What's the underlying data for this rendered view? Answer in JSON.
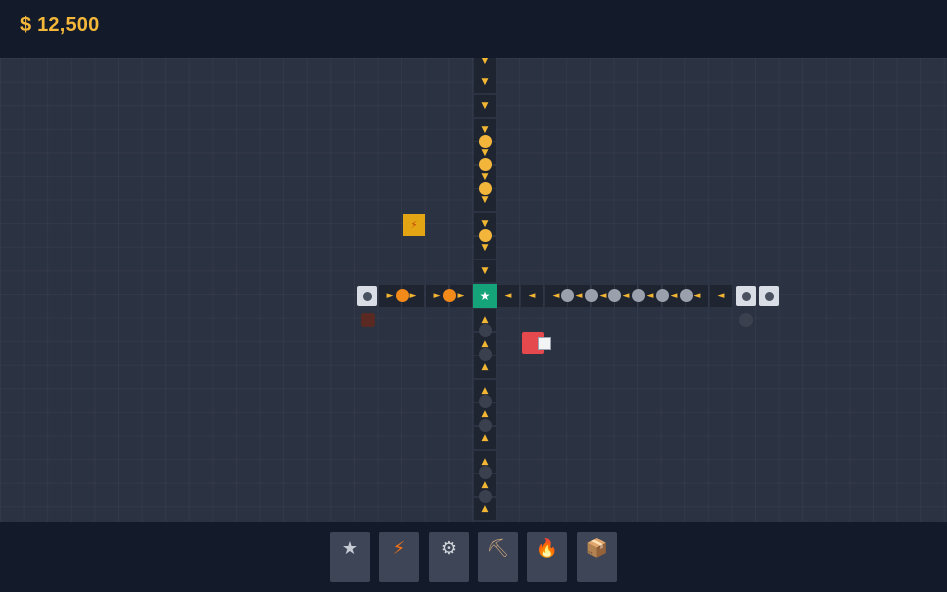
{
  "header": {
    "money": "$ 12,500"
  },
  "board": {
    "hub_icon": "star-icon",
    "hub_glyph": "★",
    "vertical_up_belt": {
      "arrow_glyph": "▼",
      "item_color": "#f4b63a"
    },
    "vertical_down_belt": {
      "arrow_glyph": "▲",
      "item_color": "#3a404e"
    },
    "left_belt": {
      "arrow_glyph": "►",
      "item_color": "#f28a1a"
    },
    "right_belt": {
      "arrow_glyph": "◄",
      "item_color": "#9aa1ad"
    },
    "bolt_tile_glyph": "⚡"
  },
  "toolbar": {
    "tools": [
      {
        "name": "star-tool",
        "icon": "star-icon",
        "glyph": "★",
        "color": "#c6cbd4"
      },
      {
        "name": "power-tool",
        "icon": "lightning-icon",
        "glyph": "⚡",
        "color": "#f97316"
      },
      {
        "name": "gear-tool",
        "icon": "gear-icon",
        "glyph": "⚙",
        "color": "#d1d5db"
      },
      {
        "name": "pickaxe-tool",
        "icon": "pickaxe-icon",
        "glyph": "⛏",
        "color": "#c4a07a"
      },
      {
        "name": "furnace-tool",
        "icon": "fire-icon",
        "glyph": "🔥",
        "color": "#f97316"
      },
      {
        "name": "crate-tool",
        "icon": "box-icon",
        "glyph": "📦",
        "color": "#d49a5a"
      }
    ]
  },
  "colors": {
    "accent_money": "#f4b73a",
    "hub": "#15a37a",
    "belt_arrow": "#f2b632"
  }
}
